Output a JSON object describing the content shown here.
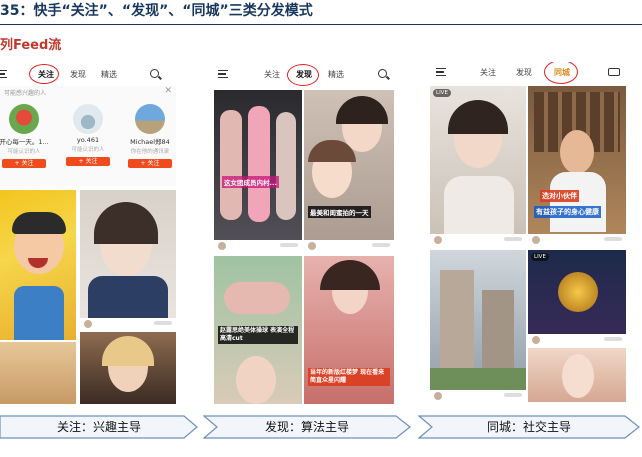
{
  "figure_title": "35：快手“关注”、“发现”、“同城”三类分发模式",
  "feed_label": "列Feed流",
  "phones": [
    {
      "tabs": {
        "follow": "关注",
        "discover": "发现",
        "featured": "精选"
      },
      "rec_header": "可能感兴趣的人",
      "users": [
        {
          "name": "开心每一天。1...",
          "sub": "可能认识的人",
          "follow": "+ 关注"
        },
        {
          "name": "yo.461",
          "sub": "可能认识的人",
          "follow": "+ 关注"
        },
        {
          "name": "Michael郑84",
          "sub": "你在他的通讯录",
          "follow": "+ 关注"
        }
      ]
    },
    {
      "tabs": {
        "follow": "关注",
        "discover": "发现",
        "featured": "精选"
      },
      "captions": [
        "这女团成员内村...",
        "最美和闺蜜拍的一天",
        "赵露思绝美体操球 表演全程高清cut",
        "当年的新版红楼梦 现在看来简直众星闪耀"
      ]
    },
    {
      "tabs": {
        "follow": "关注",
        "discover": "发现",
        "local": "同城"
      },
      "live_badges": [
        "LIVE",
        "LIVE"
      ],
      "captions": [
        "选对小伙伴",
        "有益孩子的身心健康"
      ]
    }
  ],
  "bottom_labels": [
    "关注：兴趣主导",
    "发现：算法主导",
    "同城：社交主导"
  ],
  "colors": {
    "title": "#17375e",
    "feed_label": "#c0392b",
    "highlight": "#e02020",
    "follow_button": "#f04b1d",
    "chevron_fill": "#f2f6fb",
    "chevron_stroke": "#6f8fbf"
  }
}
